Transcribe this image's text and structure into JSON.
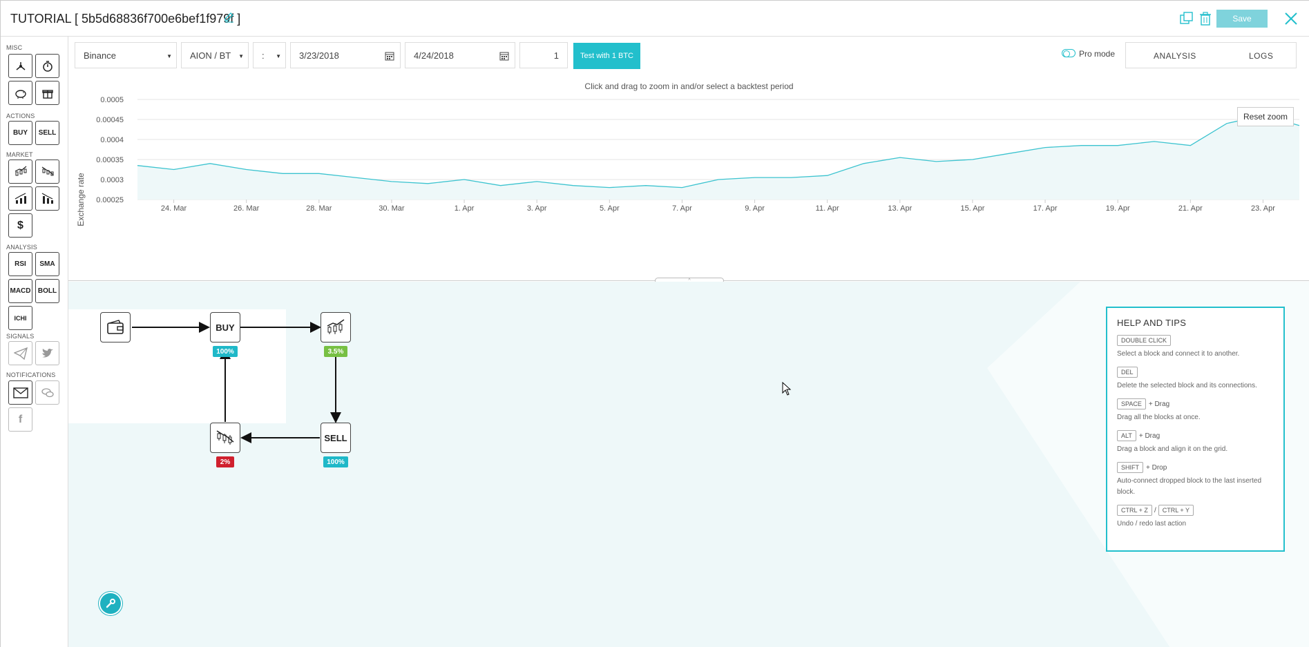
{
  "header": {
    "title": "TUTORIAL [ 5b5d68836f700e6bef1f979f ]",
    "save_label": "Save",
    "accent_color": "#22bfcc"
  },
  "sidebar": {
    "sections": {
      "misc": "MISC",
      "actions": "ACTIONS",
      "market": "MARKET",
      "analysis": "ANALYSIS",
      "signals": "SIGNALS",
      "notifications": "NOTIFICATIONS"
    },
    "actions": {
      "buy": "BUY",
      "sell": "SELL"
    },
    "market": {
      "currency": "$"
    },
    "analysis": {
      "rsi": "RSI",
      "sma": "SMA",
      "macd": "MACD",
      "boll": "BOLL",
      "ichi": "ICHI"
    },
    "notifications": {
      "facebook": "f"
    }
  },
  "toolbar": {
    "exchange": "Binance",
    "pair": "AION / BT",
    "interval": ":",
    "start_date": "3/23/2018",
    "end_date": "4/24/2018",
    "amount": "1",
    "test_button": "Test with 1 BTC",
    "pro_mode_label": "Pro mode",
    "tab_analysis": "ANALYSIS",
    "tab_logs": "LOGS"
  },
  "chart": {
    "hint": "Click and drag to zoom in and/or select a backtest period",
    "reset_zoom": "Reset zoom"
  },
  "chart_data": {
    "type": "area",
    "title": "",
    "ylabel": "Exchange rate",
    "xlabel": "",
    "ylim": [
      0.00025,
      0.0005
    ],
    "yticks": [
      "0.0005",
      "0.00045",
      "0.0004",
      "0.00035",
      "0.0003",
      "0.00025"
    ],
    "xticks": [
      "24. Mar",
      "26. Mar",
      "28. Mar",
      "30. Mar",
      "1. Apr",
      "3. Apr",
      "5. Apr",
      "7. Apr",
      "9. Apr",
      "11. Apr",
      "13. Apr",
      "15. Apr",
      "17. Apr",
      "19. Apr",
      "21. Apr",
      "23. Apr"
    ],
    "x_start": "2018-03-23",
    "x_end": "2018-04-24",
    "line_color": "#3bc3cf",
    "fill_color": "#eef8f9",
    "grid": true,
    "series": [
      {
        "x": [
          "2018-03-23",
          "2018-03-24",
          "2018-03-25",
          "2018-03-26",
          "2018-03-27",
          "2018-03-28",
          "2018-03-29",
          "2018-03-30",
          "2018-03-31",
          "2018-04-01",
          "2018-04-02",
          "2018-04-03",
          "2018-04-04",
          "2018-04-05",
          "2018-04-06",
          "2018-04-07",
          "2018-04-08",
          "2018-04-09",
          "2018-04-10",
          "2018-04-11",
          "2018-04-12",
          "2018-04-13",
          "2018-04-14",
          "2018-04-15",
          "2018-04-16",
          "2018-04-17",
          "2018-04-18",
          "2018-04-19",
          "2018-04-20",
          "2018-04-21",
          "2018-04-22",
          "2018-04-23",
          "2018-04-24"
        ],
        "values": [
          0.000335,
          0.000325,
          0.00034,
          0.000325,
          0.000315,
          0.000315,
          0.000305,
          0.000295,
          0.00029,
          0.0003,
          0.000285,
          0.000295,
          0.000285,
          0.00028,
          0.000285,
          0.00028,
          0.0003,
          0.000305,
          0.000305,
          0.00031,
          0.00034,
          0.000355,
          0.000345,
          0.00035,
          0.000365,
          0.00038,
          0.000385,
          0.000385,
          0.000395,
          0.000385,
          0.00044,
          0.00046,
          0.000435
        ]
      }
    ]
  },
  "flow": {
    "buy_label": "BUY",
    "sell_label": "SELL",
    "buy_badge": "100%",
    "rise_badge": "3.5%",
    "drop_badge": "2%",
    "sell_badge": "100%",
    "badge_teal": "#1fb8c8",
    "badge_green": "#77c043",
    "badge_red": "#d0202e"
  },
  "help": {
    "title": "HELP AND TIPS",
    "items": [
      {
        "key": "DOUBLE CLICK",
        "extra": "",
        "desc": "Select a block and connect it to another."
      },
      {
        "key": "DEL",
        "extra": "",
        "desc": "Delete the selected block and its connections."
      },
      {
        "key": "SPACE",
        "extra": "+ Drag",
        "desc": "Drag all the blocks at once."
      },
      {
        "key": "ALT",
        "extra": "+ Drag",
        "desc": "Drag a block and align it on the grid."
      },
      {
        "key": "SHIFT",
        "extra": "+ Drop",
        "desc": "Auto-connect dropped block to the last inserted block."
      }
    ],
    "undo_key": "CTRL + Z",
    "undo_sep": "/",
    "redo_key": "CTRL + Y",
    "undo_desc": "Undo / redo last action"
  }
}
